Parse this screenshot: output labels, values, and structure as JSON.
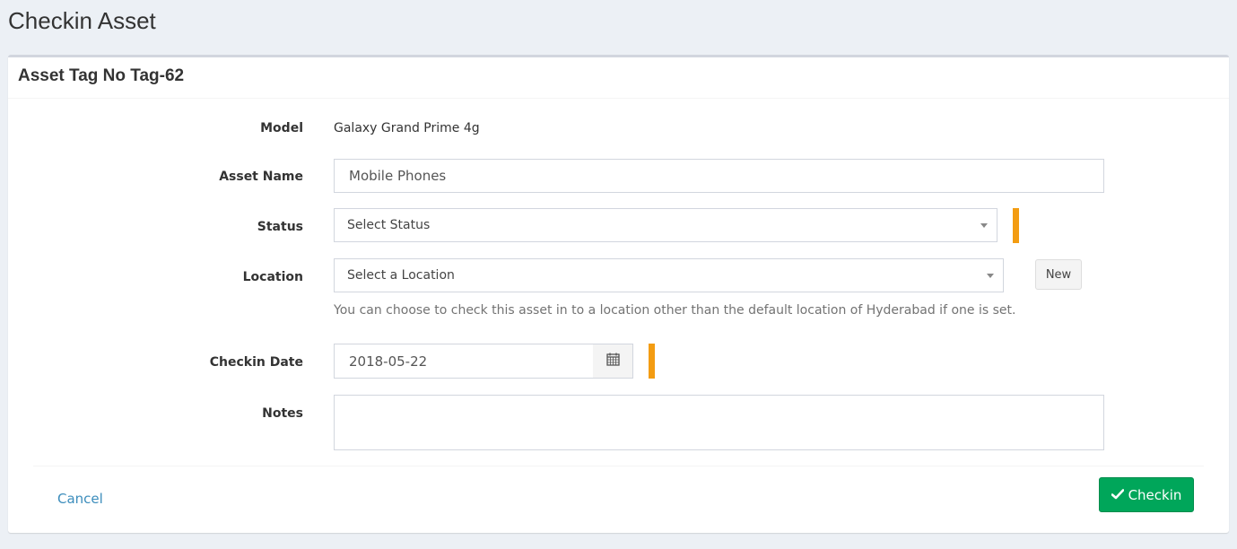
{
  "page": {
    "title": "Checkin Asset"
  },
  "box": {
    "title": "Asset Tag No Tag-62"
  },
  "form": {
    "model": {
      "label": "Model",
      "value": "Galaxy Grand Prime 4g"
    },
    "asset_name": {
      "label": "Asset Name",
      "value": "Mobile Phones"
    },
    "status": {
      "label": "Status",
      "selected": "Select Status"
    },
    "location": {
      "label": "Location",
      "selected": "Select a Location",
      "new_button": "New",
      "help": "You can choose to check this asset in to a location other than the default location of Hyderabad if one is set."
    },
    "checkin_date": {
      "label": "Checkin Date",
      "value": "2018-05-22",
      "icon": "calendar-icon"
    },
    "notes": {
      "label": "Notes",
      "value": ""
    }
  },
  "actions": {
    "cancel": "Cancel",
    "checkin": "Checkin",
    "checkin_icon": "check-icon"
  },
  "colors": {
    "background": "#ecf0f5",
    "required_marker": "#f39c12",
    "primary_button": "#00a65a",
    "link": "#3c8dbc"
  }
}
